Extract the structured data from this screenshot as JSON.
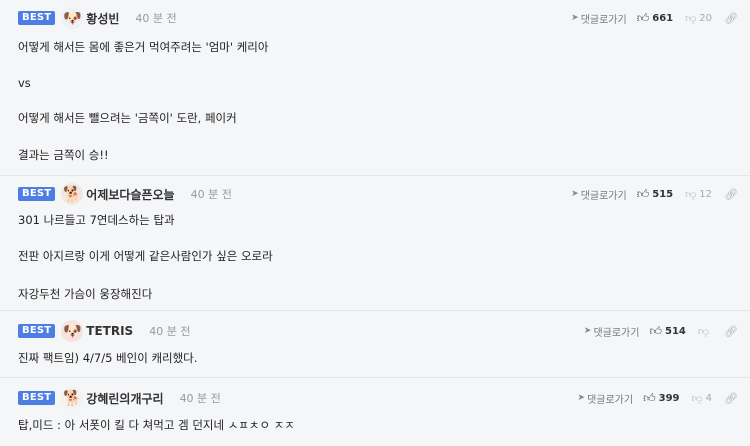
{
  "comments": [
    {
      "badge": "BEST",
      "avatar_icon": "dog-face",
      "nickname": "황성빈",
      "time": "40 분 전",
      "reply_label": "댓글로가기",
      "likes": "661",
      "dislikes": "20",
      "lines": [
        "어떻게 해서든 몸에 좋은거 먹여주려는 '엄마' 케리아",
        "vs",
        "어떻게 해서든 뺄으려는 '금쪽이' 도란, 페이커",
        "결과는 금쪽이 승!!"
      ]
    },
    {
      "badge": "BEST",
      "avatar_icon": "puppy-face",
      "nickname": "어제보다슬픈오늘",
      "time": "40 분 전",
      "reply_label": "댓글로가기",
      "likes": "515",
      "dislikes": "12",
      "lines": [
        "301 나르들고 7연데스하는 탑과",
        "전판 아지르랑 이게 어떻게 같은사람인가 싶은 오로라",
        "자강두천 가슴이 웅장해진다"
      ]
    },
    {
      "badge": "BEST",
      "avatar_icon": "santa-dog",
      "nickname": "TETRIS",
      "time": "40 분 전",
      "reply_label": "댓글로가기",
      "likes": "514",
      "dislikes": "",
      "lines": [
        "진짜 팩트임) 4/7/5 베인이 캐리했다."
      ]
    },
    {
      "badge": "BEST",
      "avatar_icon": "white-dog",
      "nickname": "강혜린의개구리",
      "time": "40 분 전",
      "reply_label": "댓글로가기",
      "likes": "399",
      "dislikes": "4",
      "lines": [
        "탑,미드 : 아 서폿이 킬 다 쳐먹고 겜 던지네 ㅅㅍㅊㅇ ㅈㅈ"
      ]
    }
  ]
}
